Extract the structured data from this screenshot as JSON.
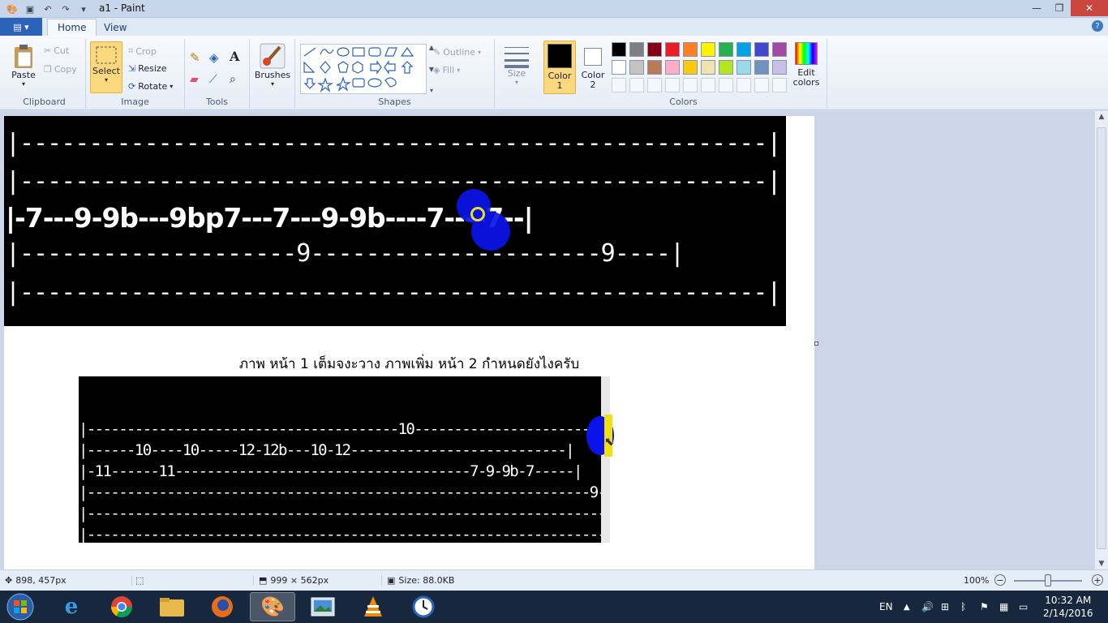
{
  "window": {
    "title": "a1 - Paint",
    "close": "✕",
    "maximize": "❐",
    "minimize": "—"
  },
  "tabs": {
    "file": "▤ ▾",
    "home": "Home",
    "view": "View",
    "help": "?"
  },
  "ribbon": {
    "clipboard": {
      "label": "Clipboard",
      "paste": "Paste",
      "cut": "Cut",
      "copy": "Copy"
    },
    "image": {
      "label": "Image",
      "select": "Select",
      "crop": "Crop",
      "resize": "Resize",
      "rotate": "Rotate"
    },
    "tools": {
      "label": "Tools"
    },
    "brushes": {
      "label": "Brushes"
    },
    "shapes": {
      "label": "Shapes",
      "outline": "Outline",
      "fill": "Fill"
    },
    "size": {
      "label": "Size"
    },
    "colors": {
      "label": "Colors",
      "color1": "Color\n1",
      "color2": "Color\n2",
      "edit": "Edit\ncolors",
      "color1_value": "#000000",
      "color2_value": "#ffffff",
      "palette_row1": [
        "#000000",
        "#7f7f7f",
        "#880015",
        "#ed1c24",
        "#ff7f27",
        "#fff200",
        "#22b14c",
        "#00a2e8",
        "#3f48cc",
        "#a349a4"
      ],
      "palette_row2": [
        "#ffffff",
        "#c3c3c3",
        "#b97a57",
        "#ffaec9",
        "#ffc90e",
        "#efe4b0",
        "#b5e61d",
        "#99d9ea",
        "#7092be",
        "#c8bfe7"
      ]
    }
  },
  "canvas": {
    "top_tab_lines": [
      "|------------------------------------------------------|",
      "|------------------------------------------------------|",
      "|-7---9-9b---9bp7---7---9-9b----7----7--|",
      "|--------------------9---------------------9----|",
      "|------------------------------------------------------|"
    ],
    "caption": "ภาพ   หน้า   1    เต็มจงะวาง   ภาพเพิ่ม   หน้า   2 กำหนดยังไงครับ",
    "bottom_tab_lines": [
      "|---------------------------------------10-----------------------|",
      "|------10----10-----12-12b---10-12---------------------------|",
      "|-11------11-------------------------------------7-9-9b-7-----|",
      "|---------------------------------------------------------------9-|",
      "|--------------------------------------------------------------------|",
      "|--------------------------------------------------------------------|"
    ]
  },
  "status": {
    "cursor": "898, 457px",
    "size": "999 × 562px",
    "filesize": "Size: 88.0KB",
    "zoom": "100%"
  },
  "taskbar": {
    "lang": "EN",
    "time": "10:32 AM",
    "date": "2/14/2016"
  }
}
